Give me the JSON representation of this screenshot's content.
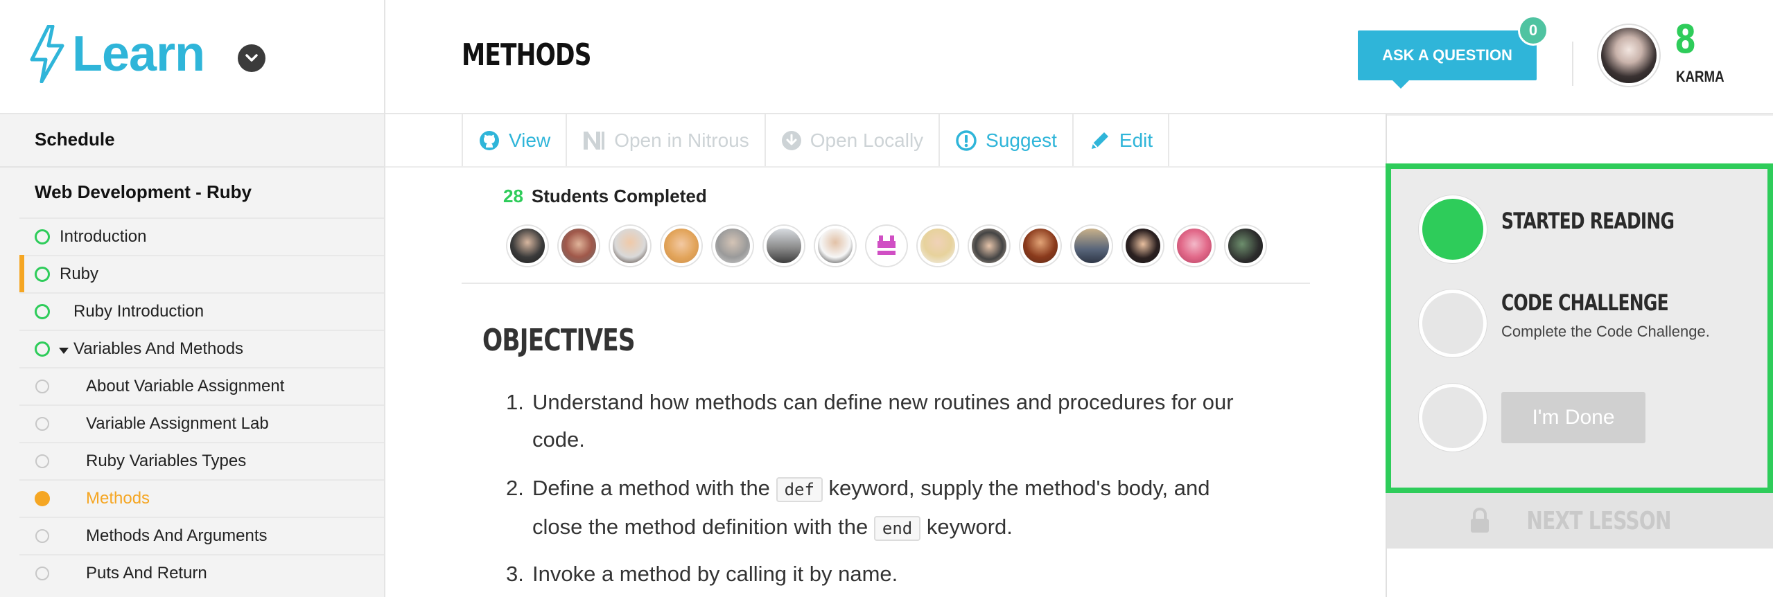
{
  "app": {
    "logo_text": "Learn"
  },
  "sidebar": {
    "schedule_label": "Schedule",
    "track_label": "Web Development - Ruby",
    "items": [
      {
        "label": "Introduction",
        "status": "complete"
      },
      {
        "label": "Ruby",
        "status": "complete"
      },
      {
        "label": "Ruby Introduction",
        "status": "complete"
      },
      {
        "label": "Variables And Methods",
        "status": "complete"
      },
      {
        "label": "About Variable Assignment",
        "status": "incomplete"
      },
      {
        "label": "Variable Assignment Lab",
        "status": "incomplete"
      },
      {
        "label": "Ruby Variables Types",
        "status": "incomplete"
      },
      {
        "label": "Methods",
        "status": "current"
      },
      {
        "label": "Methods And Arguments",
        "status": "incomplete"
      },
      {
        "label": "Puts And Return",
        "status": "incomplete"
      }
    ]
  },
  "header": {
    "page_title": "METHODS",
    "ask_button": "ASK A QUESTION",
    "ask_badge_count": "0",
    "karma_value": "8",
    "karma_label": "KARMA"
  },
  "toolbar": {
    "view": "View",
    "open_nitrous": "Open in Nitrous",
    "open_locally": "Open Locally",
    "suggest": "Suggest",
    "edit": "Edit"
  },
  "students": {
    "count": "28",
    "label": "Students Completed"
  },
  "lesson": {
    "heading": "OBJECTIVES",
    "objectives": [
      {
        "num": "1.",
        "line1": "Understand how methods can define new routines and procedures for our",
        "line2": "code."
      },
      {
        "num": "2.",
        "a": "Define a method with the",
        "code1": "def",
        "b": "keyword, supply the method's body, and",
        "c": "close the method definition with the",
        "code2": "end",
        "d": "keyword."
      },
      {
        "num": "3.",
        "line1": "Invoke a method by calling it by name."
      }
    ]
  },
  "progress": {
    "step1_title": "STARTED READING",
    "step2_title": "CODE CHALLENGE",
    "step2_sub": "Complete the Code Challenge.",
    "done_button": "I'm Done",
    "next_lesson": "NEXT LESSON"
  },
  "colors": {
    "brand_blue": "#2fb5d9",
    "success_green": "#2ecc5a",
    "current_orange": "#f5a623"
  }
}
